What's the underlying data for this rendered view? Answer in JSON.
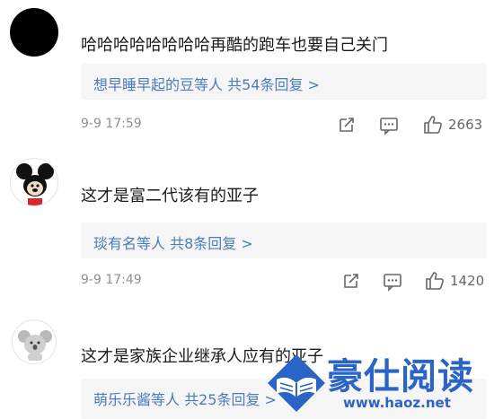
{
  "comments": [
    {
      "text": "哈哈哈哈哈哈哈哈再酷的跑车也要自己关门",
      "reply_summary": "想早睡早起的豆等人  共54条回复 >",
      "time": "9-9 17:59",
      "likes": "2663"
    },
    {
      "text": "这才是富二代该有的亚子",
      "reply_summary": "琰有名等人  共8条回复 >",
      "time": "9-9 17:49",
      "likes": "1420"
    },
    {
      "text": "这才是家族企业继承人应有的亚子",
      "reply_summary": "萌乐乐酱等人  共25条回复 >"
    }
  ],
  "icons": {
    "share": "share-icon",
    "comment": "comment-icon",
    "like": "thumbs-up-icon"
  },
  "watermark": {
    "title": "豪仕阅读",
    "url": "www.haoz.net"
  },
  "colors": {
    "link": "#4a7bbf",
    "reply_bg": "#f5f5f5",
    "muted": "#8f8f8f",
    "watermark": "#2a64c6"
  }
}
